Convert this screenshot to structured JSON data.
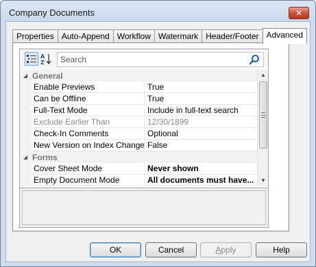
{
  "window": {
    "title": "Company Documents",
    "close_glyph": "✕"
  },
  "tabs": [
    {
      "label": "Properties"
    },
    {
      "label": "Auto-Append"
    },
    {
      "label": "Workflow"
    },
    {
      "label": "Watermark"
    },
    {
      "label": "Header/Footer"
    },
    {
      "label": "Advanced",
      "active": true
    }
  ],
  "toolbar": {
    "categorized_icon": "categorized-view-icon",
    "alphabetical_icon": "sort-alphabetical-icon",
    "search_placeholder": "Search"
  },
  "grid": {
    "categories": [
      {
        "label": "General",
        "rows": [
          {
            "name": "Enable Previews",
            "value": "True"
          },
          {
            "name": "Can be Offline",
            "value": "True"
          },
          {
            "name": "Full-Text Mode",
            "value": "Include in full-text search"
          },
          {
            "name": "Exclude Earlier Than",
            "value": "12/30/1899",
            "disabled": true
          },
          {
            "name": "Check-In Comments",
            "value": "Optional"
          },
          {
            "name": "New Version on Index Change",
            "value": "False"
          }
        ]
      },
      {
        "label": "Forms",
        "rows": [
          {
            "name": "Cover Sheet Mode",
            "value": "Never shown",
            "bold": true
          },
          {
            "name": "Empty Document Mode",
            "value": "All documents must have...",
            "bold": true
          }
        ]
      }
    ]
  },
  "buttons": {
    "ok": "OK",
    "cancel": "Cancel",
    "apply_prefix": "",
    "apply_mnemonic": "A",
    "apply_rest": "pply",
    "help": "Help"
  },
  "colors": {
    "accent": "#3c7fb1",
    "close": "#c9543a",
    "window_frame": "#cfdcec"
  }
}
